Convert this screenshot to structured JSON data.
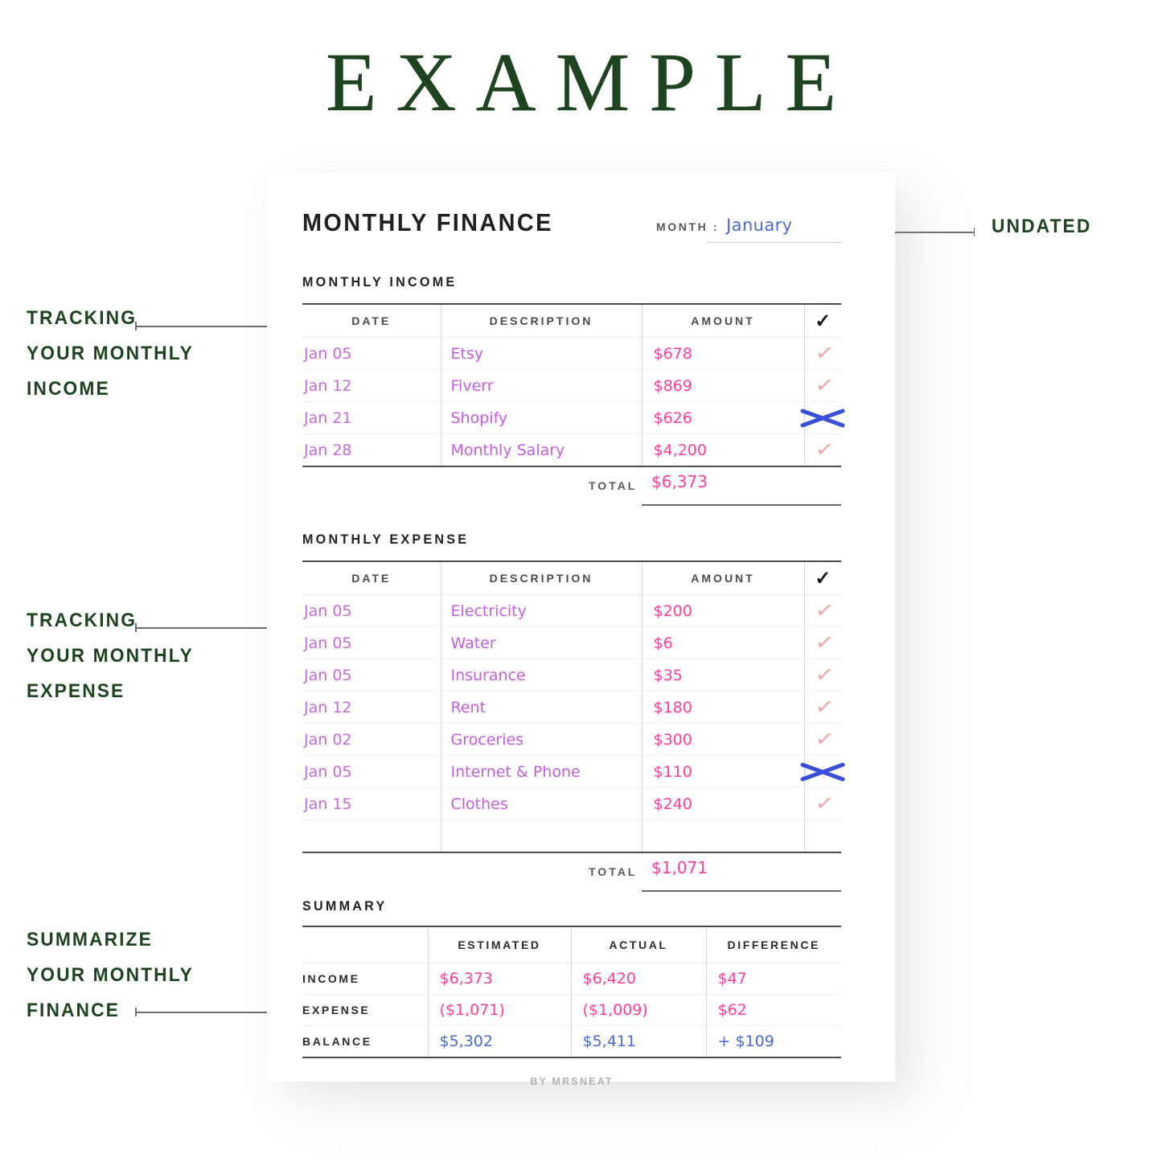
{
  "page": {
    "example_title": "EXAMPLE",
    "credit": "BY MRSNEAT",
    "colors": {
      "green": "#1e4320",
      "ink_purple": "#c96ae2",
      "ink_magenta": "#c55de0",
      "ink_pink": "#ff3f9a",
      "ink_blue": "#4a6ad8",
      "tick_pink": "#f5a6a3",
      "cross_blue": "#3a4fd8",
      "rule_dark": "#4b4b4d"
    }
  },
  "header": {
    "title": "MONTHLY FINANCE",
    "month_label": "MONTH :",
    "month_value": "January"
  },
  "income": {
    "heading": "MONTHLY INCOME",
    "columns": [
      "DATE",
      "DESCRIPTION",
      "AMOUNT"
    ],
    "check_header_icon": "check-icon",
    "rows": [
      {
        "date": "Jan 05",
        "description": "Etsy",
        "amount": "$678",
        "mark": "check"
      },
      {
        "date": "Jan 12",
        "description": "Fiverr",
        "amount": "$869",
        "mark": "check"
      },
      {
        "date": "Jan 21",
        "description": "Shopify",
        "amount": "$626",
        "mark": "cross"
      },
      {
        "date": "Jan 28",
        "description": "Monthly Salary",
        "amount": "$4,200",
        "mark": "check"
      }
    ],
    "total_label": "TOTAL",
    "total_value": "$6,373"
  },
  "expense": {
    "heading": "MONTHLY EXPENSE",
    "columns": [
      "DATE",
      "DESCRIPTION",
      "AMOUNT"
    ],
    "check_header_icon": "check-icon",
    "rows": [
      {
        "date": "Jan 05",
        "description": "Electricity",
        "amount": "$200",
        "mark": "check"
      },
      {
        "date": "Jan 05",
        "description": "Water",
        "amount": "$6",
        "mark": "check"
      },
      {
        "date": "Jan 05",
        "description": "Insurance",
        "amount": "$35",
        "mark": "check"
      },
      {
        "date": "Jan 12",
        "description": "Rent",
        "amount": "$180",
        "mark": "check"
      },
      {
        "date": "Jan 02",
        "description": "Groceries",
        "amount": "$300",
        "mark": "check"
      },
      {
        "date": "Jan 05",
        "description": "Internet & Phone",
        "amount": "$110",
        "mark": "cross"
      },
      {
        "date": "Jan 15",
        "description": "Clothes",
        "amount": "$240",
        "mark": "check"
      },
      {
        "date": "",
        "description": "",
        "amount": "",
        "mark": ""
      }
    ],
    "total_label": "TOTAL",
    "total_value": "$1,071"
  },
  "summary": {
    "heading": "SUMMARY",
    "columns": [
      "",
      "ESTIMATED",
      "ACTUAL",
      "DIFFERENCE"
    ],
    "rows": [
      {
        "label": "INCOME",
        "estimated": "$6,373",
        "actual": "$6,420",
        "difference": "$47",
        "tone": "pink"
      },
      {
        "label": "EXPENSE",
        "estimated": "($1,071)",
        "actual": "($1,009)",
        "difference": "$62",
        "tone": "pink"
      },
      {
        "label": "BALANCE",
        "estimated": "$5,302",
        "actual": "$5,411",
        "difference": "+ $109",
        "tone": "blue"
      }
    ]
  },
  "annotations": {
    "income": {
      "line1": "TRACKING",
      "line2": "YOUR MONTHLY",
      "line3": "INCOME"
    },
    "expense": {
      "line1": "TRACKING",
      "line2": "YOUR MONTHLY",
      "line3": "EXPENSE"
    },
    "summary": {
      "line1": "SUMMARIZE",
      "line2": "YOUR MONTHLY",
      "line3": "FINANCE"
    },
    "undated": "UNDATED"
  }
}
